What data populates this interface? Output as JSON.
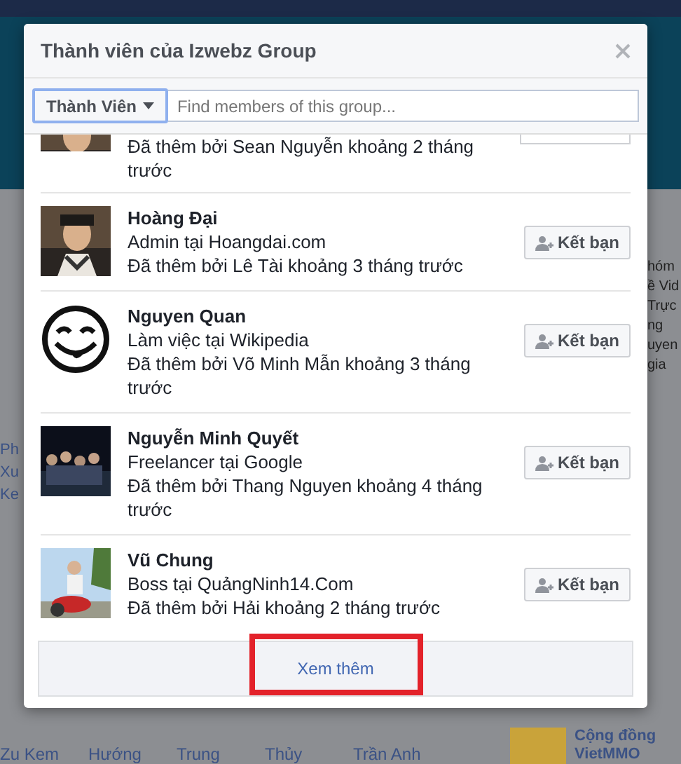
{
  "background": {
    "left_texts": [
      "Ph",
      "Xu",
      "Ke"
    ],
    "right_texts": [
      "hóm",
      "ề Vid",
      "Trực",
      "ng",
      "uyen",
      "gia"
    ],
    "bottom_names": [
      "Zu Kem",
      "Hướng",
      "Trung",
      "Thủy",
      "Trần Anh"
    ],
    "page_card": "Cộng đồng VietMMO"
  },
  "dialog": {
    "title": "Thành viên của Izwebz Group",
    "filter": {
      "label": "Thành Viên"
    },
    "search": {
      "placeholder": "Find members of this group..."
    },
    "members": [
      {
        "kind": "partial",
        "added": "Đã thêm bởi Sean Nguyễn khoảng 2 tháng trước"
      },
      {
        "kind": "full",
        "name": "Hoàng Đại",
        "work": "Admin tại Hoangdai.com",
        "added": "Đã thêm bởi Lê Tài khoảng 3 tháng trước",
        "button": "Kết bạn"
      },
      {
        "kind": "full",
        "name": "Nguyen Quan",
        "work": "Làm việc tại Wikipedia",
        "added": "Đã thêm bởi Võ Minh Mẫn khoảng 3 tháng trước",
        "button": "Kết bạn"
      },
      {
        "kind": "full",
        "name": "Nguyễn Minh Quyết",
        "work": "Freelancer tại Google",
        "added": "Đã thêm bởi Thang Nguyen khoảng 4 tháng trước",
        "button": "Kết bạn"
      },
      {
        "kind": "full",
        "name": "Vũ Chung",
        "work": "Boss tại QuảngNinh14.Com",
        "added": "Đã thêm bởi Hải khoảng 2 tháng trước",
        "button": "Kết bạn"
      }
    ],
    "more": {
      "label": "Xem thêm",
      "highlighted": true
    }
  }
}
